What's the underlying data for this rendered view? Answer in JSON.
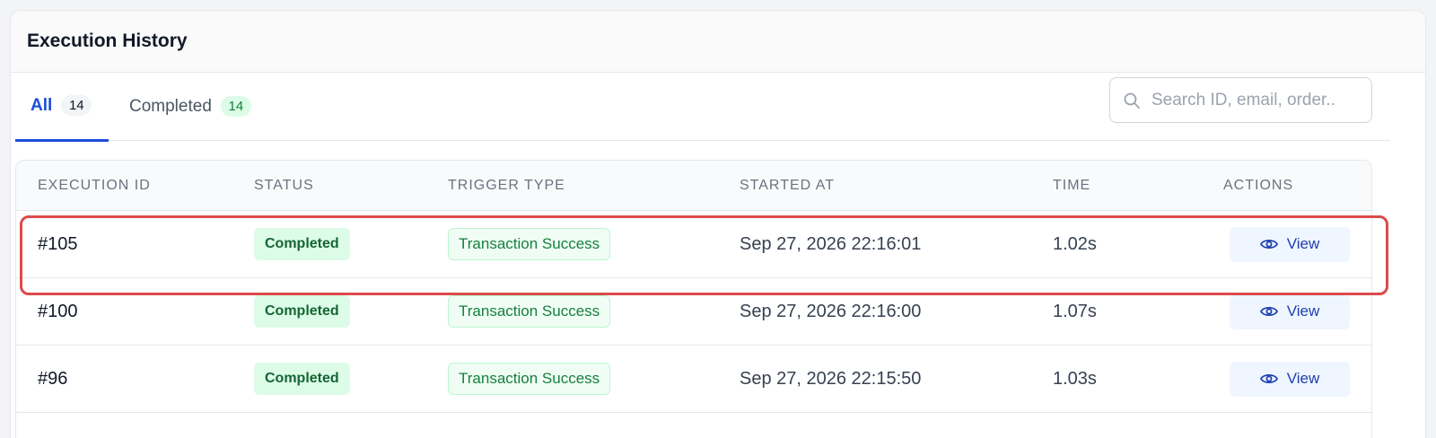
{
  "header": {
    "title": "Execution History"
  },
  "tabs": [
    {
      "label": "All",
      "count": "14"
    },
    {
      "label": "Completed",
      "count": "14"
    }
  ],
  "search": {
    "placeholder": "Search ID, email, order.."
  },
  "table": {
    "columns": [
      "EXECUTION ID",
      "STATUS",
      "TRIGGER TYPE",
      "STARTED AT",
      "TIME",
      "ACTIONS"
    ],
    "rows": [
      {
        "id": "#105",
        "status": "Completed",
        "trigger": "Transaction Success",
        "started": "Sep 27, 2026 22:16:01",
        "time": "1.02s",
        "action": "View"
      },
      {
        "id": "#100",
        "status": "Completed",
        "trigger": "Transaction Success",
        "started": "Sep 27, 2026 22:16:00",
        "time": "1.07s",
        "action": "View"
      },
      {
        "id": "#96",
        "status": "Completed",
        "trigger": "Transaction Success",
        "started": "Sep 27, 2026 22:15:50",
        "time": "1.03s",
        "action": "View"
      }
    ]
  },
  "colors": {
    "accent": "#1d4ed8",
    "success": "#15803d",
    "highlight": "#dc4a4a"
  },
  "icons": {
    "search": "search-icon",
    "view": "eye-icon"
  }
}
